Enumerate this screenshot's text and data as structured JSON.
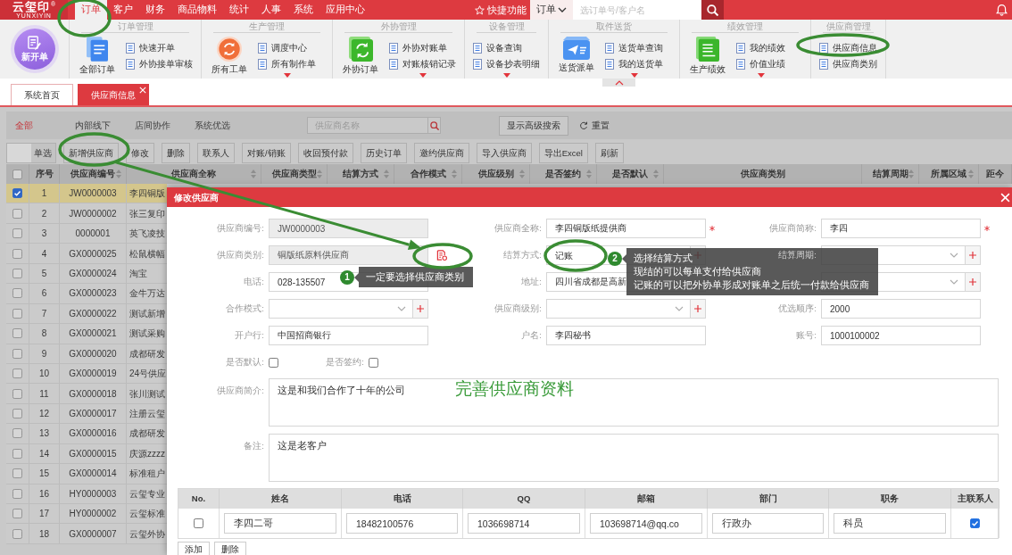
{
  "top_bar": {
    "logo": {
      "text": "云玺印",
      "registered": "®",
      "subtitle": "YUNXIYIN"
    },
    "menu": [
      {
        "label": "订单",
        "selected": true,
        "highlighted": true
      },
      {
        "label": "客户",
        "selected": false,
        "highlighted": false
      },
      {
        "label": "财务",
        "selected": false,
        "highlighted": false
      },
      {
        "label": "商品物料",
        "selected": false,
        "highlighted": false
      },
      {
        "label": "统计",
        "selected": false,
        "highlighted": false
      },
      {
        "label": "人事",
        "selected": false,
        "highlighted": false
      },
      {
        "label": "系统",
        "selected": false,
        "highlighted": false
      },
      {
        "label": "应用中心",
        "selected": false,
        "highlighted": false
      }
    ],
    "quick": "快捷功能",
    "search": {
      "scope": "订单",
      "placeholder": "选订单号/客户名"
    }
  },
  "ribbon": {
    "new_order": "新开单",
    "groups": [
      {
        "title": "订单管理",
        "main": {
          "label": "全部订单"
        },
        "items": [
          {
            "label": "快速开单",
            "highlighted": false
          },
          {
            "label": "外协接单审核",
            "highlighted": false
          }
        ],
        "more": false
      },
      {
        "title": "生产管理",
        "main": {
          "label": "所有工单"
        },
        "items": [
          {
            "label": "调度中心",
            "highlighted": false
          },
          {
            "label": "所有制作单",
            "highlighted": false
          }
        ],
        "more": true
      },
      {
        "title": "外协管理",
        "main": {
          "label": "外协订单"
        },
        "items": [
          {
            "label": "外协对账单",
            "highlighted": false
          },
          {
            "label": "对账核销记录",
            "highlighted": false
          }
        ],
        "more": true
      },
      {
        "title": "设备管理",
        "items": [
          {
            "label": "设备查询",
            "highlighted": false
          },
          {
            "label": "设备抄表明细",
            "highlighted": false
          }
        ],
        "more": true
      },
      {
        "title": "取件送货",
        "main": {
          "label": "送货派单"
        },
        "items": [
          {
            "label": "送货单查询",
            "highlighted": false
          },
          {
            "label": "我的送货单",
            "highlighted": false
          }
        ],
        "more": true
      },
      {
        "title": "绩效管理",
        "main": {
          "label": "生产绩效"
        },
        "items": [
          {
            "label": "我的绩效",
            "highlighted": false
          },
          {
            "label": "价值业绩",
            "highlighted": false
          }
        ],
        "more": true
      },
      {
        "title": "供应商管理",
        "items": [
          {
            "label": "供应商信息",
            "highlighted": true
          },
          {
            "label": "供应商类别",
            "highlighted": false
          }
        ],
        "more": false
      }
    ]
  },
  "page_tabs": [
    {
      "label": "系统首页",
      "selected": false,
      "closable": false
    },
    {
      "label": "供应商信息",
      "selected": true,
      "closable": true
    }
  ],
  "filter_bar": {
    "categories": [
      {
        "label": "全部",
        "selected": true
      },
      {
        "label": "内部线下",
        "selected": false
      },
      {
        "label": "店间协作",
        "selected": false
      },
      {
        "label": "系统优选",
        "selected": false
      }
    ],
    "search": {
      "placeholder": "供应商名称"
    },
    "advanced": "显示高级搜索",
    "reset": "重置"
  },
  "toolbar": {
    "mode": {
      "label": "单选",
      "on": false
    },
    "buttons": [
      {
        "label": "新增供应商",
        "highlighted": true
      },
      {
        "label": "修改",
        "highlighted": false
      },
      {
        "label": "删除",
        "highlighted": false
      },
      {
        "label": "联系人",
        "highlighted": false
      },
      {
        "label": "对账/销账",
        "highlighted": false
      },
      {
        "label": "收回预付款",
        "highlighted": false
      },
      {
        "label": "历史订单",
        "highlighted": false
      },
      {
        "label": "邀约供应商",
        "highlighted": false
      },
      {
        "label": "导入供应商",
        "highlighted": false
      },
      {
        "label": "导出Excel",
        "highlighted": false
      },
      {
        "label": "刷新",
        "highlighted": false
      }
    ]
  },
  "table": {
    "select_all": {
      "checked": false
    },
    "columns": [
      {
        "label": "序号",
        "sortable": false
      },
      {
        "label": "供应商编号",
        "sortable": true
      },
      {
        "label": "供应商全称",
        "sortable": true
      },
      {
        "label": "供应商类型",
        "sortable": true
      },
      {
        "label": "结算方式",
        "sortable": true
      },
      {
        "label": "合作模式",
        "sortable": true
      },
      {
        "label": "供应级别",
        "sortable": true
      },
      {
        "label": "是否签约",
        "sortable": true
      },
      {
        "label": "是否默认",
        "sortable": true
      },
      {
        "label": "供应商类别",
        "sortable": false
      },
      {
        "label": "结算周期",
        "sortable": true
      },
      {
        "label": "所属区域",
        "sortable": true
      },
      {
        "label": "距今",
        "sortable": false
      }
    ],
    "rows": [
      {
        "selected": true,
        "number": "1",
        "code": "JW0000003",
        "name": "李四铜版"
      },
      {
        "selected": false,
        "number": "2",
        "code": "JW0000002",
        "name": "张三复印"
      },
      {
        "selected": false,
        "number": "3",
        "code": "0000001",
        "name": "英飞凌技"
      },
      {
        "selected": false,
        "number": "4",
        "code": "GX0000025",
        "name": "松鼠横幅"
      },
      {
        "selected": false,
        "number": "5",
        "code": "GX0000024",
        "name": "淘宝"
      },
      {
        "selected": false,
        "number": "6",
        "code": "GX0000023",
        "name": "金牛万达"
      },
      {
        "selected": false,
        "number": "7",
        "code": "GX0000022",
        "name": "测试新增"
      },
      {
        "selected": false,
        "number": "8",
        "code": "GX0000021",
        "name": "测试采购"
      },
      {
        "selected": false,
        "number": "9",
        "code": "GX0000020",
        "name": "成都研发"
      },
      {
        "selected": false,
        "number": "10",
        "code": "GX0000019",
        "name": "24号供应"
      },
      {
        "selected": false,
        "number": "11",
        "code": "GX0000018",
        "name": "张川测试"
      },
      {
        "selected": false,
        "number": "12",
        "code": "GX0000017",
        "name": "注册云玺"
      },
      {
        "selected": false,
        "number": "13",
        "code": "GX0000016",
        "name": "成都研发"
      },
      {
        "selected": false,
        "number": "14",
        "code": "GX0000015",
        "name": "庆源zzzz"
      },
      {
        "selected": false,
        "number": "15",
        "code": "GX0000014",
        "name": "标准租户"
      },
      {
        "selected": false,
        "number": "16",
        "code": "HY0000003",
        "name": "云玺专业"
      },
      {
        "selected": false,
        "number": "17",
        "code": "HY0000002",
        "name": "云玺标准"
      },
      {
        "selected": false,
        "number": "18",
        "code": "GX0000007",
        "name": "云玺外协"
      }
    ]
  },
  "modal": {
    "title": "修改供应商",
    "rows": [
      [
        {
          "label": "供应商编号:",
          "kind": "input",
          "value": "JW0000003",
          "disabled": true,
          "required": false,
          "highlighted": false
        },
        {
          "label": "供应商全称:",
          "kind": "input",
          "value": "李四铜版纸提供商",
          "disabled": false,
          "required": true,
          "highlighted": false
        },
        {
          "label": "供应商简称:",
          "kind": "input",
          "value": "李四",
          "disabled": false,
          "required": true,
          "highlighted": false
        }
      ],
      [
        {
          "label": "供应商类别:",
          "kind": "input",
          "value": "铜版纸原料供应商",
          "disabled": true,
          "required": false,
          "highlighted": false,
          "picker": {
            "highlighted": true
          }
        },
        {
          "label": "结算方式:",
          "kind": "select",
          "value": "记账",
          "disabled": false,
          "required": false,
          "highlighted": true
        },
        {
          "label": "结算周期:",
          "kind": "select",
          "disabled": false,
          "required": false,
          "highlighted": false
        }
      ],
      [
        {
          "label": "电话:",
          "kind": "input",
          "value": "028-135507",
          "disabled": false,
          "required": false,
          "highlighted": false
        },
        {
          "label": "地址:",
          "kind": "input",
          "value": "四川省成都是高新",
          "disabled": false,
          "required": false,
          "highlighted": false
        },
        {
          "kind": "select",
          "disabled": false,
          "required": false,
          "highlighted": false
        }
      ],
      [
        {
          "label": "合作模式:",
          "kind": "select",
          "disabled": false,
          "required": false,
          "highlighted": false
        },
        {
          "label": "供应商级别:",
          "kind": "select",
          "disabled": false,
          "required": false,
          "highlighted": false
        },
        {
          "label": "优选顺序:",
          "kind": "input",
          "value": "2000",
          "disabled": false,
          "required": false,
          "highlighted": false
        }
      ],
      [
        {
          "label": "开户行:",
          "kind": "input",
          "value": "中国招商银行",
          "disabled": false,
          "required": false,
          "highlighted": false
        },
        {
          "label": "户名:",
          "kind": "input",
          "value": "李四秘书",
          "disabled": false,
          "required": false,
          "highlighted": false
        },
        {
          "label": "账号:",
          "kind": "input",
          "value": "1000100002",
          "disabled": false,
          "required": false,
          "highlighted": false
        }
      ],
      [
        {
          "label": "是否默认:",
          "kind": "checkbox",
          "checked": false,
          "highlighted": false
        },
        {
          "label": "是否签约:",
          "kind": "checkbox",
          "checked": false,
          "highlighted": false
        }
      ]
    ],
    "intro": {
      "label": "供应商简介:",
      "value": "这是和我们合作了十年的公司"
    },
    "remark": {
      "label": "备注:",
      "value": "这是老客户"
    },
    "contacts": {
      "columns": [
        "No.",
        "姓名",
        "电话",
        "QQ",
        "邮箱",
        "部门",
        "职务",
        "主联系人"
      ],
      "rows": [
        {
          "selected": false,
          "name": "李四二哥",
          "phone": "18482100576",
          "qq": "1036698714",
          "email": "103698714@qq.co",
          "department": "行政办",
          "position": "科员",
          "primary": true
        }
      ]
    },
    "buttons": [
      "添加",
      "删除"
    ]
  },
  "annotations": {
    "callouts": [
      {
        "number": "1",
        "lines": [
          "一定要选择供应商类别"
        ]
      },
      {
        "number": "2",
        "lines": [
          "选择结算方式",
          "现结的可以每单支付给供应商",
          "记账的可以把外协单形成对账单之后统一付款给供应商"
        ]
      }
    ],
    "caption": "完善供应商资料"
  }
}
